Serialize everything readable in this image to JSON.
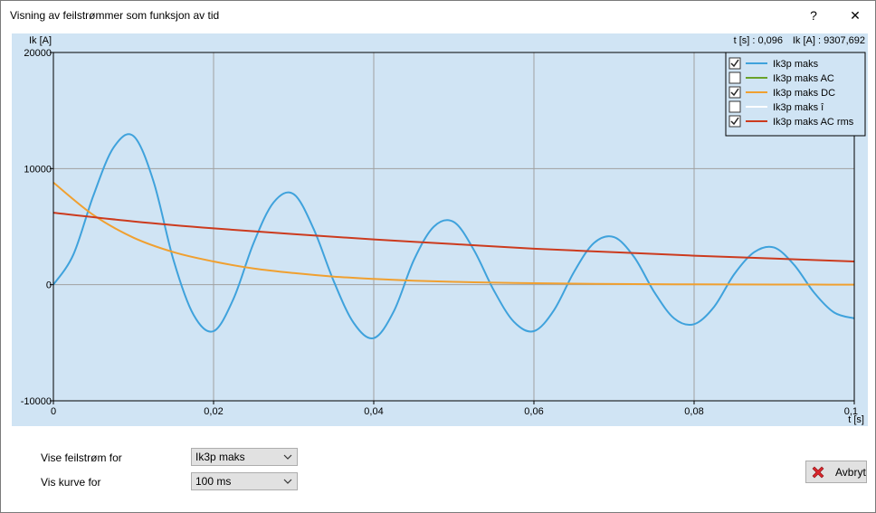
{
  "window": {
    "title": "Visning av feilstrømmer som funksjon av tid",
    "help_label": "?",
    "close_label": "✕"
  },
  "readout": {
    "t": "t [s] : 0,096",
    "ik": "Ik [A] : 9307,692"
  },
  "controls": {
    "vise_label": "Vise feilstrøm for",
    "vise_value": "Ik3p maks",
    "kurve_label": "Vis kurve for",
    "kurve_value": "100 ms",
    "cancel_label": "Avbryt"
  },
  "colors": {
    "plot_bg": "#d0e4f4",
    "grid": "#a0a0a0",
    "ik3p": "#3fa2dc",
    "ac": "#6aa22a",
    "dc": "#f0a030",
    "peak": "#ffffff",
    "rms": "#cc3b1e"
  },
  "chart_data": {
    "type": "line",
    "xlabel": "t [s]",
    "ylabel": "Ik [A]",
    "xlim": [
      0,
      0.1
    ],
    "ylim": [
      -10000,
      20000
    ],
    "x_ticks": [
      0,
      0.02,
      0.04,
      0.06,
      0.08,
      0.1
    ],
    "x_tick_labels": [
      "0",
      "0,02",
      "0,04",
      "0,06",
      "0,08",
      "0,1"
    ],
    "y_ticks": [
      -10000,
      0,
      10000,
      20000
    ],
    "y_tick_labels": [
      "-10000",
      "0",
      "10000",
      "20000"
    ],
    "grid": true,
    "legend_position": "top-right",
    "series": [
      {
        "name": "Ik3p maks",
        "checked": true,
        "color": "#3fa2dc",
        "x": [
          0,
          0.0025,
          0.005,
          0.0075,
          0.01,
          0.0125,
          0.015,
          0.0175,
          0.02,
          0.0225,
          0.025,
          0.0275,
          0.03,
          0.0325,
          0.035,
          0.0375,
          0.04,
          0.0425,
          0.045,
          0.0475,
          0.05,
          0.0525,
          0.055,
          0.0575,
          0.06,
          0.0625,
          0.065,
          0.0675,
          0.07,
          0.0725,
          0.075,
          0.0775,
          0.08,
          0.0825,
          0.085,
          0.0875,
          0.09,
          0.0925,
          0.095,
          0.0975,
          0.1
        ],
        "y": [
          0,
          2600,
          7700,
          11800,
          12800,
          8900,
          2100,
          -2600,
          -4000,
          -1200,
          3600,
          7100,
          7800,
          4800,
          300,
          -3300,
          -4600,
          -2300,
          2100,
          5000,
          5400,
          3000,
          -500,
          -3200,
          -4000,
          -2200,
          1100,
          3600,
          4100,
          2400,
          -600,
          -2900,
          -3400,
          -1900,
          900,
          2800,
          3200,
          1700,
          -700,
          -2400,
          -2900
        ]
      },
      {
        "name": "Ik3p maks AC",
        "checked": false,
        "color": "#6aa22a",
        "x": [],
        "y": []
      },
      {
        "name": "Ik3p maks DC",
        "checked": true,
        "color": "#f0a030",
        "x": [
          0,
          0.005,
          0.01,
          0.015,
          0.02,
          0.025,
          0.03,
          0.035,
          0.04,
          0.045,
          0.05,
          0.055,
          0.06,
          0.065,
          0.07,
          0.075,
          0.08,
          0.085,
          0.09,
          0.095,
          0.1
        ],
        "y": [
          8800,
          6000,
          4050,
          2800,
          2000,
          1400,
          1000,
          700,
          500,
          350,
          250,
          180,
          130,
          90,
          60,
          45,
          30,
          20,
          15,
          10,
          5
        ]
      },
      {
        "name": "Ik3p maks î",
        "checked": false,
        "color": "#ffffff",
        "x": [],
        "y": []
      },
      {
        "name": "Ik3p maks AC rms",
        "checked": true,
        "color": "#cc3b1e",
        "x": [
          0,
          0.01,
          0.02,
          0.03,
          0.04,
          0.05,
          0.06,
          0.07,
          0.08,
          0.09,
          0.1
        ],
        "y": [
          6200,
          5450,
          4850,
          4350,
          3900,
          3500,
          3100,
          2800,
          2500,
          2250,
          2000
        ]
      }
    ]
  }
}
